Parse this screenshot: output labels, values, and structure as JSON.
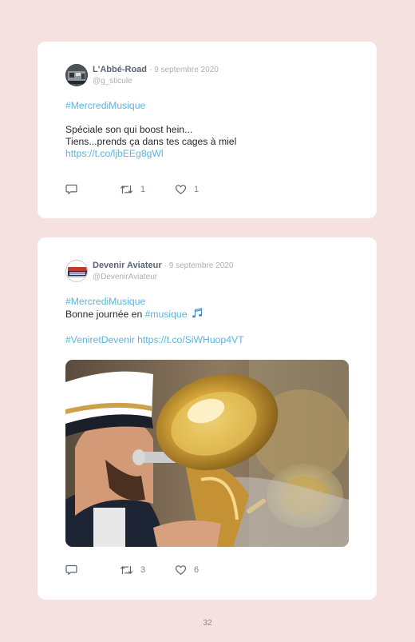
{
  "tweets": [
    {
      "author": "L'Abbé-Road",
      "date": "· 9 septembre 2020",
      "handle": "@g_sticule",
      "hashtag": "#MercrediMusique",
      "line1": "Spéciale son qui boost hein...",
      "line2": "Tiens...prends ça dans tes cages à miel",
      "link": "https://t.co/ljbEEg8gWl",
      "replies": "",
      "retweets": "1",
      "likes": "1"
    },
    {
      "author": "Devenir Aviateur",
      "date": "· 9 septembre 2020",
      "handle": "@DevenirAviateur",
      "hashtag": "#MercrediMusique",
      "line_prefix": "Bonne journée en ",
      "hashtag2": "#musique",
      "note_icon": "music-note-emoji",
      "hashtag3": "#VeniretDevenir",
      "link": "https://t.co/SiWHuop4VT",
      "photo": "tuba-player-in-naval-uniform",
      "replies": "",
      "retweets": "3",
      "likes": "6"
    }
  ],
  "page_number": "32",
  "colors": {
    "background": "#f5e1df",
    "card": "#ffffff",
    "link": "#5bb4e2",
    "author": "#5b6472",
    "muted": "#a9b0b7"
  }
}
